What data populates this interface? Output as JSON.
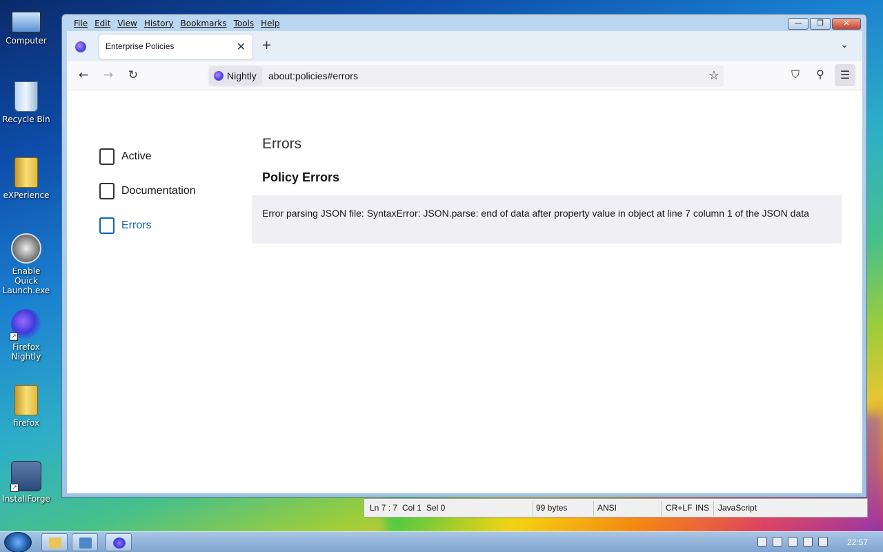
{
  "desktop": {
    "icons": [
      {
        "label": "Computer",
        "icon": "computer-icon"
      },
      {
        "label": "Recycle Bin",
        "icon": "recycle-bin-icon"
      },
      {
        "label": "eXPerience",
        "icon": "folder-icon"
      },
      {
        "label": "Enable Quick Launch.exe",
        "icon": "quick-launch-icon"
      },
      {
        "label": "Firefox Nightly",
        "icon": "firefox-nightly-icon"
      },
      {
        "label": "firefox",
        "icon": "folder-icon"
      },
      {
        "label": "InstallForge",
        "icon": "installforge-icon"
      }
    ]
  },
  "window": {
    "menu": [
      "File",
      "Edit",
      "View",
      "History",
      "Bookmarks",
      "Tools",
      "Help"
    ],
    "controls": {
      "minimize": "—",
      "restore": "❐",
      "close": "✕"
    }
  },
  "tab": {
    "title": "Enterprise Policies",
    "close": "✕",
    "new": "+",
    "list": "⌄"
  },
  "nav": {
    "back": "←",
    "forward": "→",
    "reload": "↻",
    "identity": "Nightly",
    "url": "about:policies#errors",
    "bookmark_star": "☆",
    "pocket": "⛉",
    "extensions": "⚲",
    "menu": "☰"
  },
  "page": {
    "sidebar": [
      {
        "label": "Active",
        "selected": false
      },
      {
        "label": "Documentation",
        "selected": false
      },
      {
        "label": "Errors",
        "selected": true
      }
    ],
    "heading": "Errors",
    "section_title": "Policy Errors",
    "error_message": "Error parsing JSON file: SyntaxError: JSON.parse: end of data after property value in object at line 7 column 1 of the JSON data"
  },
  "statusbar": {
    "position": "Ln 7 : 7",
    "col": "Col 1",
    "sel": "Sel 0",
    "size": "99 bytes",
    "encoding": "ANSI",
    "eol": "CR+LF",
    "mode": "INS",
    "language": "JavaScript"
  },
  "taskbar": {
    "clock": "22:57"
  },
  "colors": {
    "accent": "#0b61c4",
    "error_bg": "#f0f0f4"
  }
}
